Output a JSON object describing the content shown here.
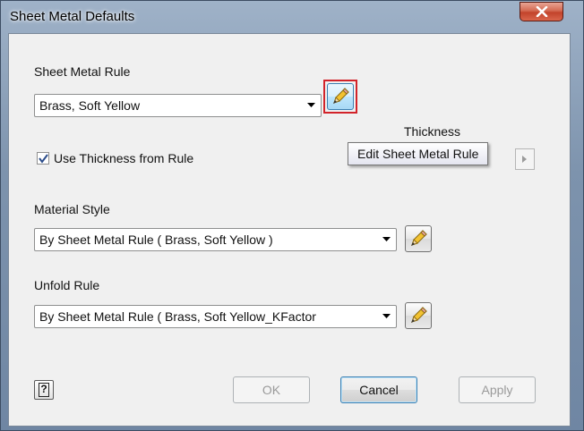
{
  "window": {
    "title": "Sheet Metal Defaults"
  },
  "sheet_metal_rule": {
    "label": "Sheet Metal Rule",
    "value": "Brass, Soft Yellow"
  },
  "thickness": {
    "label": "Thickness",
    "use_from_rule_label": "Use Thickness from Rule",
    "use_from_rule_checked": true
  },
  "tooltip": {
    "text": "Edit Sheet Metal Rule"
  },
  "material_style": {
    "label": "Material Style",
    "value": "By Sheet Metal Rule ( Brass, Soft Yellow )"
  },
  "unfold_rule": {
    "label": "Unfold Rule",
    "value": "By Sheet Metal Rule ( Brass, Soft Yellow_KFactor"
  },
  "buttons": {
    "help_glyph": "?",
    "ok": "OK",
    "cancel": "Cancel",
    "apply": "Apply"
  },
  "colors": {
    "highlight": "#d2232a",
    "close_button": "#c2432b"
  },
  "icons": [
    "close-icon",
    "pencil-icon",
    "chevron-down-icon",
    "checkmark-icon",
    "chevron-right-icon",
    "help-icon"
  ]
}
